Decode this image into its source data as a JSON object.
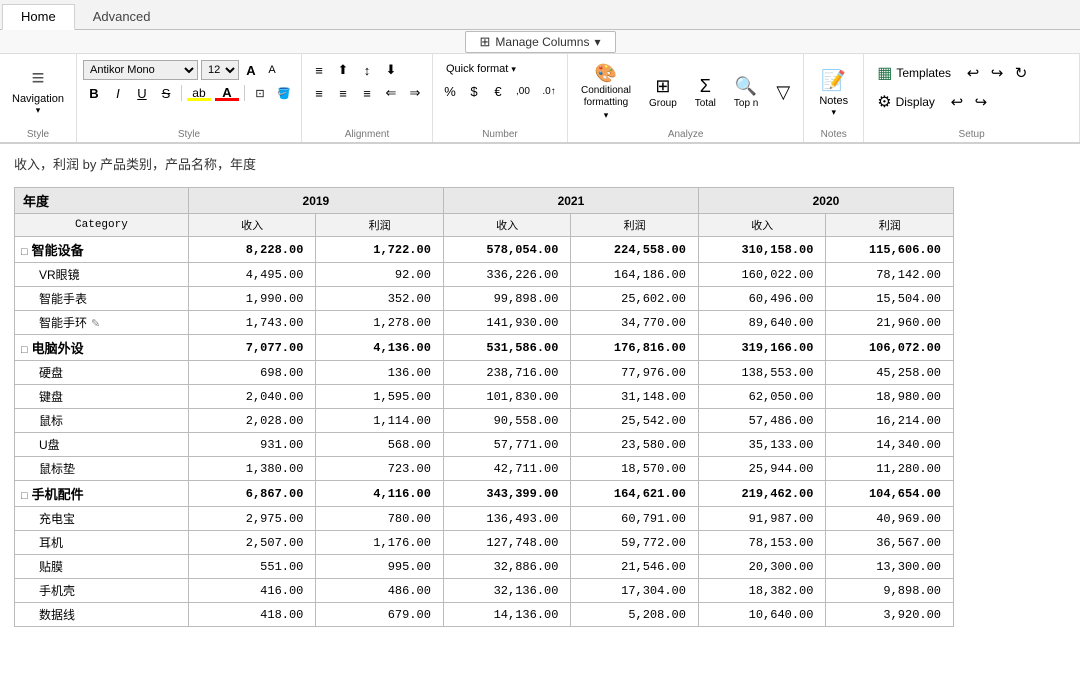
{
  "tabs": [
    {
      "id": "home",
      "label": "Home",
      "active": true
    },
    {
      "id": "advanced",
      "label": "Advanced",
      "active": false
    }
  ],
  "ribbon": {
    "navigation": {
      "label": "Navigation",
      "icon": "☰"
    },
    "style_group_label": "Style",
    "font": {
      "name": "Antikor Mono",
      "size": "12"
    },
    "alignment_group_label": "Alignment",
    "number_group_label": "Number",
    "quick_format": {
      "label": "Quick format",
      "arrow": "▾"
    },
    "conditional_formatting": {
      "label": "Conditional\nformatting",
      "arrow": "▾"
    },
    "analyze_group_label": "Analyze",
    "group_btn": "Group",
    "total_btn": "Total",
    "top_n_btn": "Top n",
    "notes": {
      "label": "Notes",
      "arrow": "▾"
    },
    "notes_group_label": "Notes",
    "templates": {
      "label": "Templates"
    },
    "display": {
      "label": "Display"
    },
    "setup_group_label": "Setup",
    "manage_columns": "Manage Columns"
  },
  "report": {
    "title": "收入，利润 by 产品类别，产品名称，年度",
    "year_label_col": "年度",
    "col_headers": [
      "Category",
      "收入",
      "利润",
      "收入",
      "利润",
      "收入",
      "利润"
    ],
    "year_headers": [
      {
        "label": "2019",
        "span": 2
      },
      {
        "label": "2021",
        "span": 2
      },
      {
        "label": "2020",
        "span": 2
      }
    ],
    "rows": [
      {
        "type": "category",
        "label": "智能设备",
        "collapsed": false,
        "values": [
          "8,228.00",
          "1,722.00",
          "578,054.00",
          "224,558.00",
          "310,158.00",
          "115,606.00"
        ]
      },
      {
        "type": "subcategory",
        "label": "VR眼镜",
        "values": [
          "4,495.00",
          "92.00",
          "336,226.00",
          "164,186.00",
          "160,022.00",
          "78,142.00"
        ]
      },
      {
        "type": "subcategory",
        "label": "智能手表",
        "values": [
          "1,990.00",
          "352.00",
          "99,898.00",
          "25,602.00",
          "60,496.00",
          "15,504.00"
        ]
      },
      {
        "type": "subcategory",
        "label": "智能手环",
        "values": [
          "1,743.00",
          "1,278.00",
          "141,930.00",
          "34,770.00",
          "89,640.00",
          "21,960.00"
        ],
        "edit": true
      },
      {
        "type": "category",
        "label": "电脑外设",
        "collapsed": false,
        "values": [
          "7,077.00",
          "4,136.00",
          "531,586.00",
          "176,816.00",
          "319,166.00",
          "106,072.00"
        ]
      },
      {
        "type": "subcategory",
        "label": "硬盘",
        "values": [
          "698.00",
          "136.00",
          "238,716.00",
          "77,976.00",
          "138,553.00",
          "45,258.00"
        ]
      },
      {
        "type": "subcategory",
        "label": "键盘",
        "values": [
          "2,040.00",
          "1,595.00",
          "101,830.00",
          "31,148.00",
          "62,050.00",
          "18,980.00"
        ]
      },
      {
        "type": "subcategory",
        "label": "鼠标",
        "values": [
          "2,028.00",
          "1,114.00",
          "90,558.00",
          "25,542.00",
          "57,486.00",
          "16,214.00"
        ]
      },
      {
        "type": "subcategory",
        "label": "U盘",
        "values": [
          "931.00",
          "568.00",
          "57,771.00",
          "23,580.00",
          "35,133.00",
          "14,340.00"
        ]
      },
      {
        "type": "subcategory",
        "label": "鼠标垫",
        "values": [
          "1,380.00",
          "723.00",
          "42,711.00",
          "18,570.00",
          "25,944.00",
          "11,280.00"
        ]
      },
      {
        "type": "category",
        "label": "手机配件",
        "collapsed": false,
        "values": [
          "6,867.00",
          "4,116.00",
          "343,399.00",
          "164,621.00",
          "219,462.00",
          "104,654.00"
        ]
      },
      {
        "type": "subcategory",
        "label": "充电宝",
        "values": [
          "2,975.00",
          "780.00",
          "136,493.00",
          "60,791.00",
          "91,987.00",
          "40,969.00"
        ]
      },
      {
        "type": "subcategory",
        "label": "耳机",
        "values": [
          "2,507.00",
          "1,176.00",
          "127,748.00",
          "59,772.00",
          "78,153.00",
          "36,567.00"
        ]
      },
      {
        "type": "subcategory",
        "label": "贴膜",
        "values": [
          "551.00",
          "995.00",
          "32,886.00",
          "21,546.00",
          "20,300.00",
          "13,300.00"
        ]
      },
      {
        "type": "subcategory",
        "label": "手机壳",
        "values": [
          "416.00",
          "486.00",
          "32,136.00",
          "17,304.00",
          "18,382.00",
          "9,898.00"
        ]
      },
      {
        "type": "subcategory",
        "label": "数据线",
        "values": [
          "418.00",
          "679.00",
          "14,136.00",
          "5,208.00",
          "10,640.00",
          "3,920.00"
        ]
      }
    ]
  }
}
